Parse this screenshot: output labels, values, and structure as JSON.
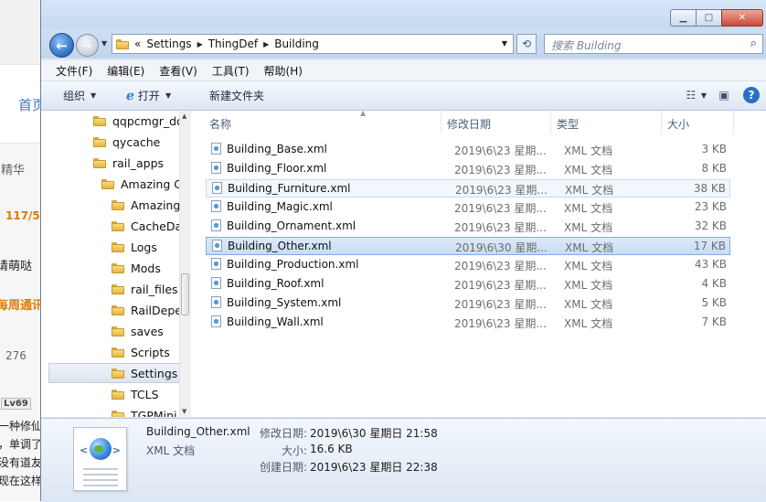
{
  "background_page": {
    "nav_text": "首页",
    "jinghua": "精华",
    "page_count": "117/5",
    "user_text": "请萌哒",
    "weekly_text": "每周通讯",
    "post_count": "276",
    "level_badge": "Lv69",
    "lines": [
      "一种修仙",
      "，单调了",
      "没有道友",
      "现在这样"
    ]
  },
  "window": {
    "caption_buttons": [
      "minimize",
      "maximize",
      "close"
    ],
    "address": {
      "overflow": "«",
      "crumbs": [
        "Settings",
        "ThingDef",
        "Building"
      ]
    },
    "search_placeholder": "搜索 Building",
    "menu": [
      "文件(F)",
      "编辑(E)",
      "查看(V)",
      "工具(T)",
      "帮助(H)"
    ],
    "toolbar": {
      "organize": "组织",
      "open": "打开",
      "new_folder": "新建文件夹"
    },
    "tree": [
      {
        "label": "qqpcmgr_do",
        "indent": 0
      },
      {
        "label": "qycache",
        "indent": 0
      },
      {
        "label": "rail_apps",
        "indent": 0
      },
      {
        "label": "Amazing C",
        "indent": 1
      },
      {
        "label": "Amazing",
        "indent": 2
      },
      {
        "label": "CacheDa",
        "indent": 2
      },
      {
        "label": "Logs",
        "indent": 2
      },
      {
        "label": "Mods",
        "indent": 2
      },
      {
        "label": "rail_files",
        "indent": 2
      },
      {
        "label": "RailDepe",
        "indent": 2
      },
      {
        "label": "saves",
        "indent": 2
      },
      {
        "label": "Scripts",
        "indent": 2
      },
      {
        "label": "Settings",
        "indent": 2,
        "selected": true
      },
      {
        "label": "TCLS",
        "indent": 2
      },
      {
        "label": "TGPMini",
        "indent": 2
      }
    ],
    "columns": {
      "name": "名称",
      "modified": "修改日期",
      "type": "类型",
      "size": "大小"
    },
    "files": [
      {
        "name": "Building_Base.xml",
        "modified": "2019\\6\\23 星期...",
        "type": "XML 文档",
        "size": "3 KB"
      },
      {
        "name": "Building_Floor.xml",
        "modified": "2019\\6\\23 星期...",
        "type": "XML 文档",
        "size": "8 KB"
      },
      {
        "name": "Building_Furniture.xml",
        "modified": "2019\\6\\23 星期...",
        "type": "XML 文档",
        "size": "38 KB",
        "hover": true
      },
      {
        "name": "Building_Magic.xml",
        "modified": "2019\\6\\23 星期...",
        "type": "XML 文档",
        "size": "23 KB"
      },
      {
        "name": "Building_Ornament.xml",
        "modified": "2019\\6\\23 星期...",
        "type": "XML 文档",
        "size": "32 KB"
      },
      {
        "name": "Building_Other.xml",
        "modified": "2019\\6\\30 星期...",
        "type": "XML 文档",
        "size": "17 KB",
        "selected": true
      },
      {
        "name": "Building_Production.xml",
        "modified": "2019\\6\\23 星期...",
        "type": "XML 文档",
        "size": "43 KB"
      },
      {
        "name": "Building_Roof.xml",
        "modified": "2019\\6\\23 星期...",
        "type": "XML 文档",
        "size": "4 KB"
      },
      {
        "name": "Building_System.xml",
        "modified": "2019\\6\\23 星期...",
        "type": "XML 文档",
        "size": "5 KB"
      },
      {
        "name": "Building_Wall.xml",
        "modified": "2019\\6\\23 星期...",
        "type": "XML 文档",
        "size": "7 KB"
      }
    ],
    "details": {
      "file_name": "Building_Other.xml",
      "file_type": "XML 文档",
      "modified_label": "修改日期:",
      "modified_value": "2019\\6\\30 星期日 21:58",
      "size_label": "大小:",
      "size_value": "16.6 KB",
      "created_label": "创建日期:",
      "created_value": "2019\\6\\23 星期日 22:38"
    },
    "colors": {
      "selection": "#c7dcf4",
      "chrome": "#dfe9f5"
    }
  }
}
